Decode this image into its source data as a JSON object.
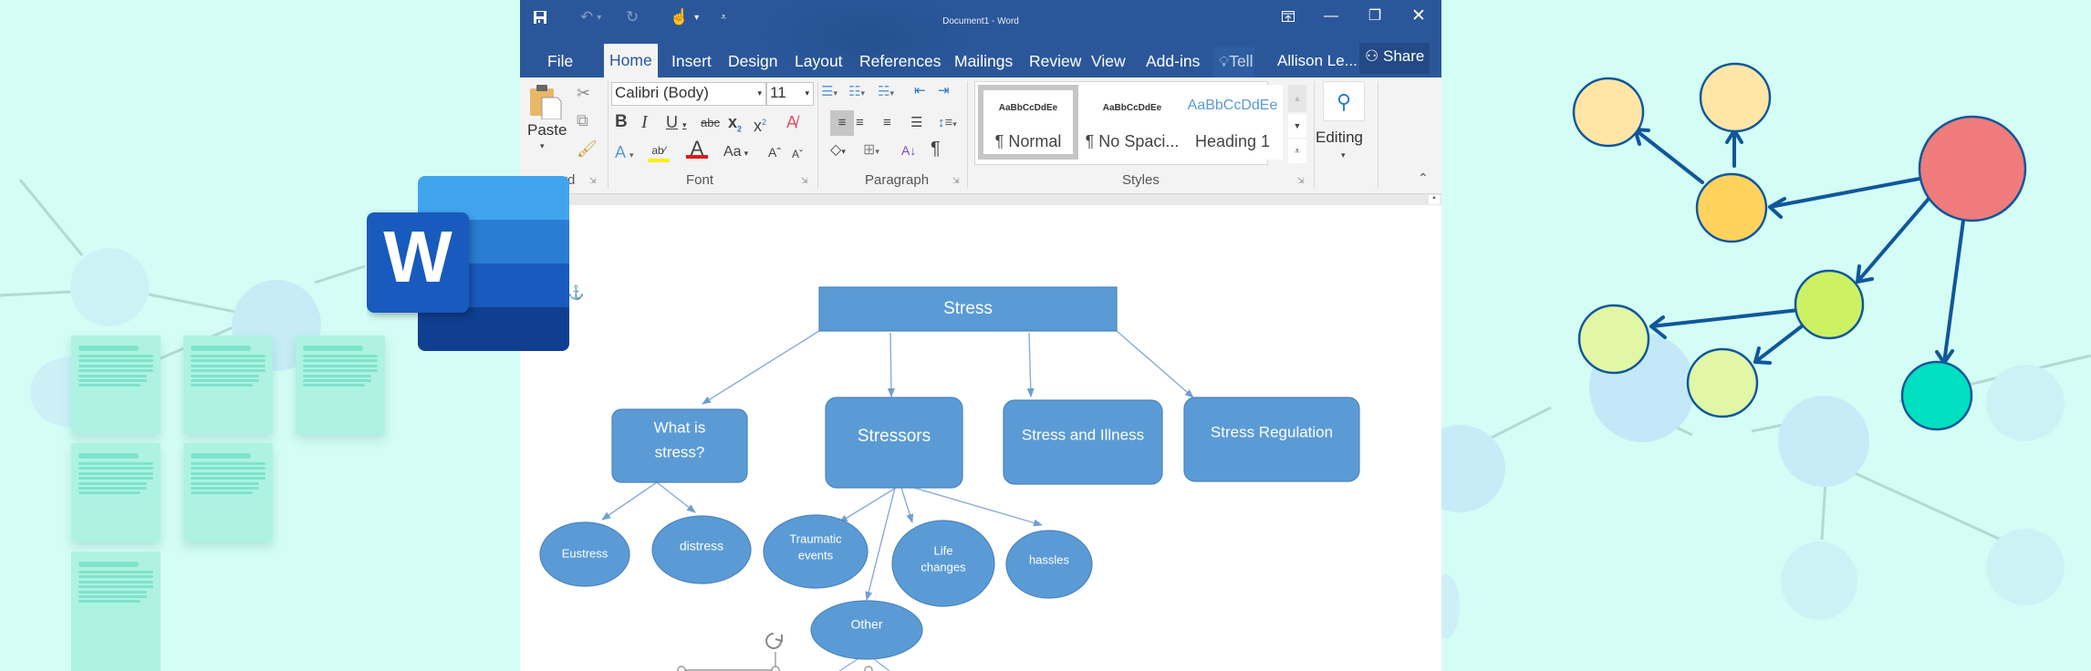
{
  "window": {
    "title": "Document1 - Word",
    "qat": {
      "save_icon": "save-icon",
      "undo_icon": "undo-icon",
      "redo_icon": "redo-icon",
      "touch_mode_icon": "touch-mode-icon",
      "customize_icon": "customize-qat-icon"
    },
    "controls": {
      "ribbon_display_icon": "ribbon-display-options-icon",
      "minimize": "—",
      "restore": "❐",
      "close": "✕"
    }
  },
  "tabs": [
    {
      "label": "File",
      "active": false
    },
    {
      "label": "Home",
      "active": true
    },
    {
      "label": "Insert",
      "active": false
    },
    {
      "label": "Design",
      "active": false
    },
    {
      "label": "Layout",
      "active": false
    },
    {
      "label": "References",
      "active": false
    },
    {
      "label": "Mailings",
      "active": false
    },
    {
      "label": "Review",
      "active": false
    },
    {
      "label": "View",
      "active": false
    },
    {
      "label": "Add-ins",
      "active": false
    }
  ],
  "tell_me": "Tell",
  "user": "Allison Le...",
  "share": "Share",
  "ribbon": {
    "clipboard": {
      "paste": "Paste",
      "label": "rd"
    },
    "font": {
      "name": "Calibri (Body)",
      "size": "11",
      "label": "Font",
      "highlight_color": "#ffee00",
      "font_color": "#e0191b"
    },
    "paragraph": {
      "label": "Paragraph"
    },
    "styles": {
      "label": "Styles",
      "items": [
        {
          "preview": "AaBbCcDdEe",
          "name": "¶ Normal",
          "selected": true
        },
        {
          "preview": "AaBbCcDdEe",
          "name": "¶ No Spaci...",
          "selected": false
        },
        {
          "preview": "AaBbCcDdEe",
          "name": "Heading 1",
          "selected": false
        }
      ]
    },
    "editing": {
      "label": "Editing"
    }
  },
  "diagram": {
    "fill": "#5b9bd5",
    "root": "Stress",
    "level1": [
      "What is stress?",
      "Stressors",
      "Stress and Illness",
      "Stress Regulation"
    ],
    "what_is_stress_children": [
      "Eustress",
      "distress"
    ],
    "stressors_children": [
      "Traumatic events",
      "Life changes",
      "hassles",
      "Other"
    ]
  },
  "background": {
    "color": "#d4fdf6",
    "graph_colors": {
      "root": "#f07b7b",
      "orange": "#ffd35e",
      "peach": "#ffe6a6",
      "lime": "#ccf264",
      "pale_lime": "#e1f7a6",
      "teal": "#00dfbf",
      "edge": "#10579a"
    }
  }
}
